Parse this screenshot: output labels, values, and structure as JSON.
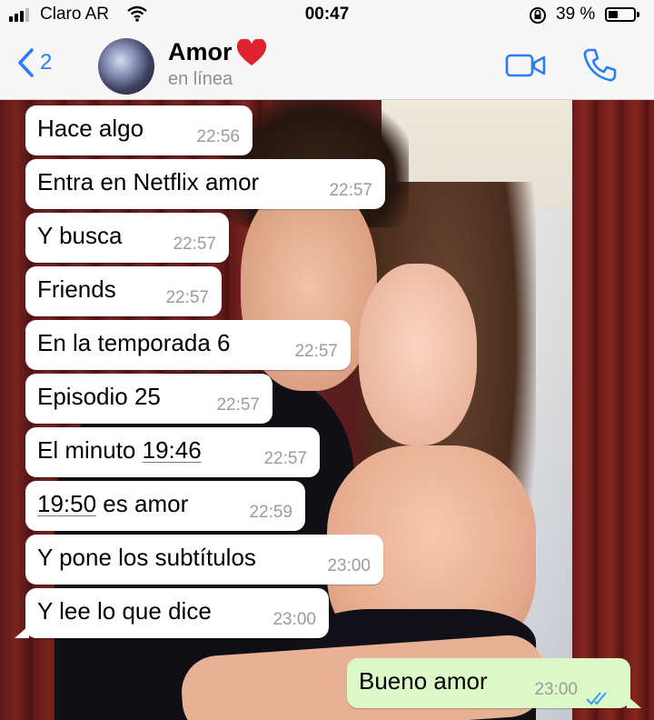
{
  "status_bar": {
    "carrier": "Claro AR",
    "time": "00:47",
    "battery_percent": "39 %",
    "battery_level": 0.39
  },
  "header": {
    "back_count": "2",
    "contact_name": "Amor",
    "contact_status": "en línea"
  },
  "messages": [
    {
      "text": "Hace algo",
      "time": "22:56",
      "direction": "in"
    },
    {
      "text": "Entra en Netflix amor",
      "time": "22:57",
      "direction": "in"
    },
    {
      "text": "Y busca",
      "time": "22:57",
      "direction": "in"
    },
    {
      "text": "Friends",
      "time": "22:57",
      "direction": "in"
    },
    {
      "text": "En la temporada 6",
      "time": "22:57",
      "direction": "in"
    },
    {
      "text": "Episodio 25",
      "time": "22:57",
      "direction": "in"
    },
    {
      "text_prefix": "El minuto ",
      "text_link": "19:46",
      "time": "22:57",
      "direction": "in"
    },
    {
      "text_link": "19:50",
      "text_suffix": " es amor",
      "time": "22:59",
      "direction": "in"
    },
    {
      "text": "Y pone los subtítulos",
      "time": "23:00",
      "direction": "in"
    },
    {
      "text": "Y lee lo que dice",
      "time": "23:00",
      "direction": "in"
    },
    {
      "text": "Bueno amor",
      "time": "23:00",
      "direction": "out",
      "status": "read"
    }
  ],
  "colors": {
    "accent": "#2a7df5",
    "incoming_bubble": "#ffffff",
    "outgoing_bubble": "#dcf8c6",
    "heart": "#e0212e",
    "read_ticks": "#34a0f2"
  }
}
